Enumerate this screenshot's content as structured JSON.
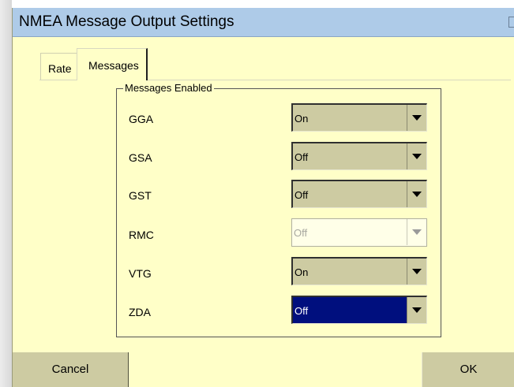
{
  "window": {
    "title": "NMEA Message Output Settings"
  },
  "tabs": [
    {
      "label": "Rate",
      "active": false
    },
    {
      "label": "Messages",
      "active": true
    }
  ],
  "group": {
    "legend": "Messages Enabled"
  },
  "messages": [
    {
      "name": "GGA",
      "value": "On",
      "state": "normal"
    },
    {
      "name": "GSA",
      "value": "Off",
      "state": "normal"
    },
    {
      "name": "GST",
      "value": "Off",
      "state": "normal"
    },
    {
      "name": "RMC",
      "value": "Off",
      "state": "disabled"
    },
    {
      "name": "VTG",
      "value": "On",
      "state": "normal"
    },
    {
      "name": "ZDA",
      "value": "Off",
      "state": "selected"
    }
  ],
  "buttons": {
    "cancel": "Cancel",
    "ok": "OK"
  },
  "colors": {
    "background": "#ffffc8",
    "titlebar": "#aecbe8",
    "control": "#cdcba2",
    "selection": "#000f7e"
  }
}
